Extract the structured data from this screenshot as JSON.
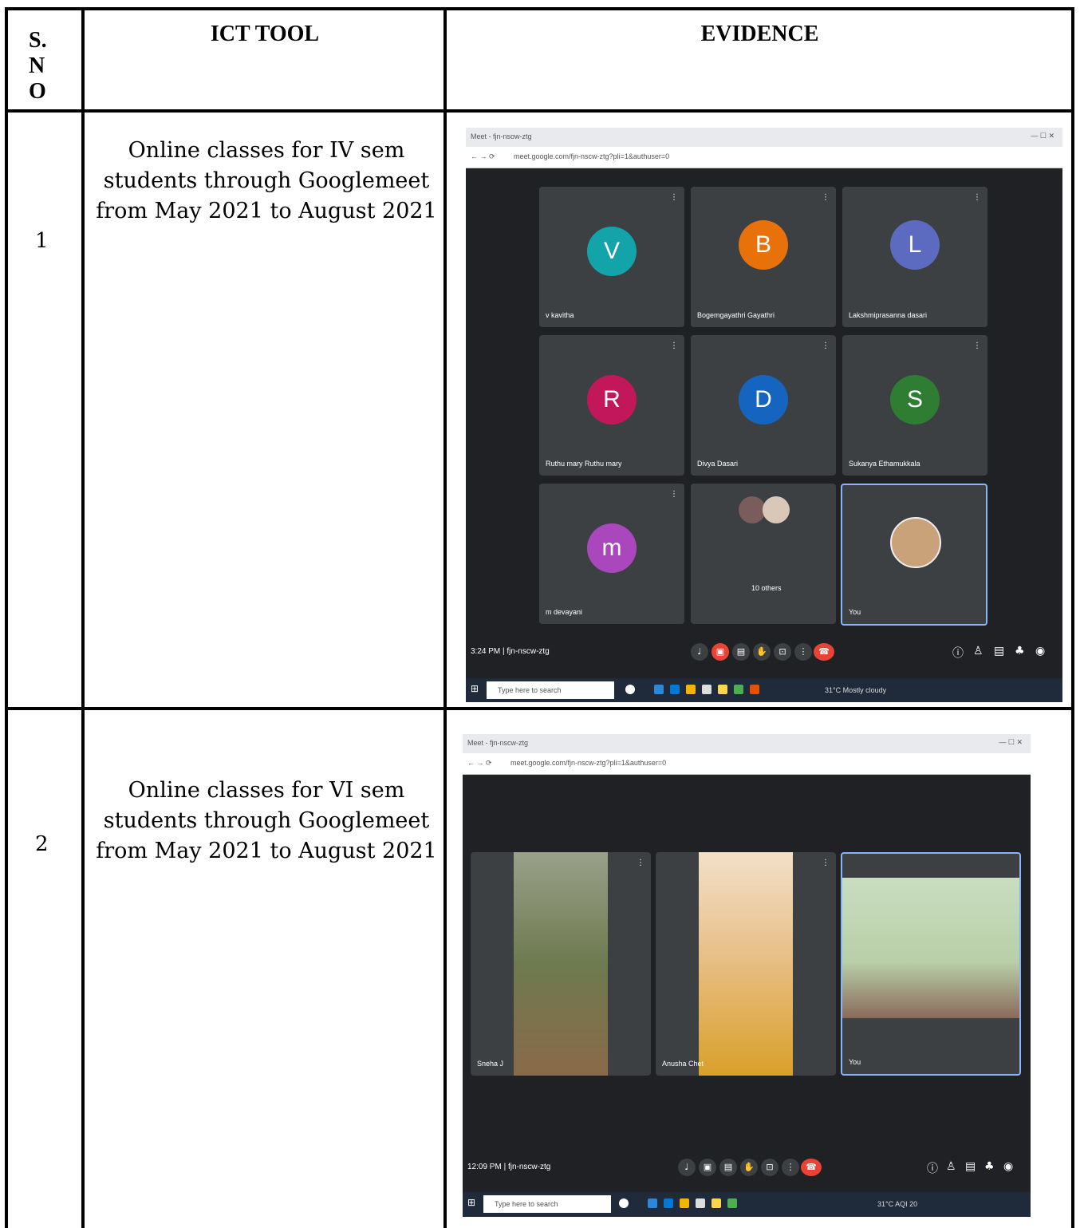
{
  "table": {
    "headers": {
      "sno": [
        "S.",
        "N",
        "O"
      ],
      "ict_tool": "ICT TOOL",
      "evidence": "EVIDENCE"
    },
    "rows": [
      {
        "sno": "1",
        "ict_tool": "Online classes for IV sem students through Googlemeet from May 2021 to August 2021"
      },
      {
        "sno": "2",
        "ict_tool": "Online classes for VI sem students through Googlemeet from May 2021 to August 2021"
      }
    ]
  },
  "screenshot1": {
    "tab_title": "Meet - fjn-nsow-ztg",
    "url": "meet.google.com/fjn-nscw-ztg?pli=1&authuser=0",
    "tiles": [
      {
        "initial": "V",
        "name": "v kavitha",
        "color": "#12a4a8"
      },
      {
        "initial": "B",
        "name": "Bogemgayathri Gayathri",
        "color": "#e8710a"
      },
      {
        "initial": "L",
        "name": "Lakshmiprasanna dasari",
        "color": "#5c6bc0"
      },
      {
        "initial": "R",
        "name": "Ruthu mary Ruthu mary",
        "color": "#c2185b"
      },
      {
        "initial": "D",
        "name": "Divya Dasari",
        "color": "#1565c0"
      },
      {
        "initial": "S",
        "name": "Sukanya Ethamukkala",
        "color": "#2e7d32"
      },
      {
        "initial": "m",
        "name": "m devayani",
        "color": "#ab47bc"
      },
      {
        "initial": "",
        "name": "10 others",
        "color": "#3c4043"
      },
      {
        "initial": "",
        "name": "You",
        "color": "#3c4043"
      }
    ],
    "meeting_time": "3:24 PM | fjn-nscw-ztg",
    "taskbar_search": "Type here to search",
    "weather": "31°C Mostly cloudy"
  },
  "screenshot2": {
    "tab_title": "Meet - fjn-nscw-ztg",
    "url": "meet.google.com/fjn-nscw-ztg?pli=1&authuser=0",
    "tiles": [
      {
        "name": "Sneha J"
      },
      {
        "name": "Anusha Chet"
      },
      {
        "name": "You"
      }
    ],
    "meeting_time": "12:09 PM | fjn-nscw-ztg",
    "taskbar_search": "Type here to search",
    "weather": "31°C AQI 20"
  }
}
